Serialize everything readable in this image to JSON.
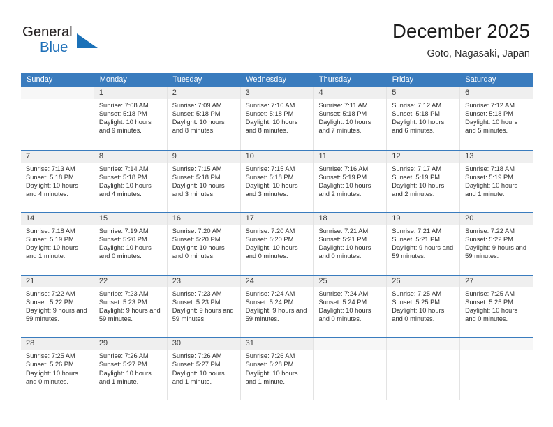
{
  "brand": {
    "name_top": "General",
    "name_bottom": "Blue",
    "triangle_icon": "triangle-icon",
    "color_black": "#231f20",
    "color_blue": "#1d6fb8"
  },
  "header": {
    "title": "December 2025",
    "subtitle": "Goto, Nagasaki, Japan"
  },
  "theme": {
    "header_blue": "#3a7cbe",
    "daynum_band": "#efefef",
    "cell_background": "#ffffff",
    "grid_line": "#e3e3e3",
    "text": "#2e2e2e"
  },
  "weekday_headers": [
    "Sunday",
    "Monday",
    "Tuesday",
    "Wednesday",
    "Thursday",
    "Friday",
    "Saturday"
  ],
  "labels": {
    "sunrise_prefix": "Sunrise:",
    "sunset_prefix": "Sunset:",
    "daylight_prefix": "Daylight:"
  },
  "weeks": [
    [
      {
        "empty": true
      },
      {
        "day": "1",
        "sunrise": "Sunrise: 7:08 AM",
        "sunset": "Sunset: 5:18 PM",
        "daylight": "Daylight: 10 hours and 9 minutes."
      },
      {
        "day": "2",
        "sunrise": "Sunrise: 7:09 AM",
        "sunset": "Sunset: 5:18 PM",
        "daylight": "Daylight: 10 hours and 8 minutes."
      },
      {
        "day": "3",
        "sunrise": "Sunrise: 7:10 AM",
        "sunset": "Sunset: 5:18 PM",
        "daylight": "Daylight: 10 hours and 8 minutes."
      },
      {
        "day": "4",
        "sunrise": "Sunrise: 7:11 AM",
        "sunset": "Sunset: 5:18 PM",
        "daylight": "Daylight: 10 hours and 7 minutes."
      },
      {
        "day": "5",
        "sunrise": "Sunrise: 7:12 AM",
        "sunset": "Sunset: 5:18 PM",
        "daylight": "Daylight: 10 hours and 6 minutes."
      },
      {
        "day": "6",
        "sunrise": "Sunrise: 7:12 AM",
        "sunset": "Sunset: 5:18 PM",
        "daylight": "Daylight: 10 hours and 5 minutes."
      }
    ],
    [
      {
        "day": "7",
        "sunrise": "Sunrise: 7:13 AM",
        "sunset": "Sunset: 5:18 PM",
        "daylight": "Daylight: 10 hours and 4 minutes."
      },
      {
        "day": "8",
        "sunrise": "Sunrise: 7:14 AM",
        "sunset": "Sunset: 5:18 PM",
        "daylight": "Daylight: 10 hours and 4 minutes."
      },
      {
        "day": "9",
        "sunrise": "Sunrise: 7:15 AM",
        "sunset": "Sunset: 5:18 PM",
        "daylight": "Daylight: 10 hours and 3 minutes."
      },
      {
        "day": "10",
        "sunrise": "Sunrise: 7:15 AM",
        "sunset": "Sunset: 5:18 PM",
        "daylight": "Daylight: 10 hours and 3 minutes."
      },
      {
        "day": "11",
        "sunrise": "Sunrise: 7:16 AM",
        "sunset": "Sunset: 5:19 PM",
        "daylight": "Daylight: 10 hours and 2 minutes."
      },
      {
        "day": "12",
        "sunrise": "Sunrise: 7:17 AM",
        "sunset": "Sunset: 5:19 PM",
        "daylight": "Daylight: 10 hours and 2 minutes."
      },
      {
        "day": "13",
        "sunrise": "Sunrise: 7:18 AM",
        "sunset": "Sunset: 5:19 PM",
        "daylight": "Daylight: 10 hours and 1 minute."
      }
    ],
    [
      {
        "day": "14",
        "sunrise": "Sunrise: 7:18 AM",
        "sunset": "Sunset: 5:19 PM",
        "daylight": "Daylight: 10 hours and 1 minute."
      },
      {
        "day": "15",
        "sunrise": "Sunrise: 7:19 AM",
        "sunset": "Sunset: 5:20 PM",
        "daylight": "Daylight: 10 hours and 0 minutes."
      },
      {
        "day": "16",
        "sunrise": "Sunrise: 7:20 AM",
        "sunset": "Sunset: 5:20 PM",
        "daylight": "Daylight: 10 hours and 0 minutes."
      },
      {
        "day": "17",
        "sunrise": "Sunrise: 7:20 AM",
        "sunset": "Sunset: 5:20 PM",
        "daylight": "Daylight: 10 hours and 0 minutes."
      },
      {
        "day": "18",
        "sunrise": "Sunrise: 7:21 AM",
        "sunset": "Sunset: 5:21 PM",
        "daylight": "Daylight: 10 hours and 0 minutes."
      },
      {
        "day": "19",
        "sunrise": "Sunrise: 7:21 AM",
        "sunset": "Sunset: 5:21 PM",
        "daylight": "Daylight: 9 hours and 59 minutes."
      },
      {
        "day": "20",
        "sunrise": "Sunrise: 7:22 AM",
        "sunset": "Sunset: 5:22 PM",
        "daylight": "Daylight: 9 hours and 59 minutes."
      }
    ],
    [
      {
        "day": "21",
        "sunrise": "Sunrise: 7:22 AM",
        "sunset": "Sunset: 5:22 PM",
        "daylight": "Daylight: 9 hours and 59 minutes."
      },
      {
        "day": "22",
        "sunrise": "Sunrise: 7:23 AM",
        "sunset": "Sunset: 5:23 PM",
        "daylight": "Daylight: 9 hours and 59 minutes."
      },
      {
        "day": "23",
        "sunrise": "Sunrise: 7:23 AM",
        "sunset": "Sunset: 5:23 PM",
        "daylight": "Daylight: 9 hours and 59 minutes."
      },
      {
        "day": "24",
        "sunrise": "Sunrise: 7:24 AM",
        "sunset": "Sunset: 5:24 PM",
        "daylight": "Daylight: 9 hours and 59 minutes."
      },
      {
        "day": "25",
        "sunrise": "Sunrise: 7:24 AM",
        "sunset": "Sunset: 5:24 PM",
        "daylight": "Daylight: 10 hours and 0 minutes."
      },
      {
        "day": "26",
        "sunrise": "Sunrise: 7:25 AM",
        "sunset": "Sunset: 5:25 PM",
        "daylight": "Daylight: 10 hours and 0 minutes."
      },
      {
        "day": "27",
        "sunrise": "Sunrise: 7:25 AM",
        "sunset": "Sunset: 5:25 PM",
        "daylight": "Daylight: 10 hours and 0 minutes."
      }
    ],
    [
      {
        "day": "28",
        "sunrise": "Sunrise: 7:25 AM",
        "sunset": "Sunset: 5:26 PM",
        "daylight": "Daylight: 10 hours and 0 minutes."
      },
      {
        "day": "29",
        "sunrise": "Sunrise: 7:26 AM",
        "sunset": "Sunset: 5:27 PM",
        "daylight": "Daylight: 10 hours and 1 minute."
      },
      {
        "day": "30",
        "sunrise": "Sunrise: 7:26 AM",
        "sunset": "Sunset: 5:27 PM",
        "daylight": "Daylight: 10 hours and 1 minute."
      },
      {
        "day": "31",
        "sunrise": "Sunrise: 7:26 AM",
        "sunset": "Sunset: 5:28 PM",
        "daylight": "Daylight: 10 hours and 1 minute."
      },
      {
        "empty": true
      },
      {
        "empty": true
      },
      {
        "empty": true
      }
    ]
  ]
}
